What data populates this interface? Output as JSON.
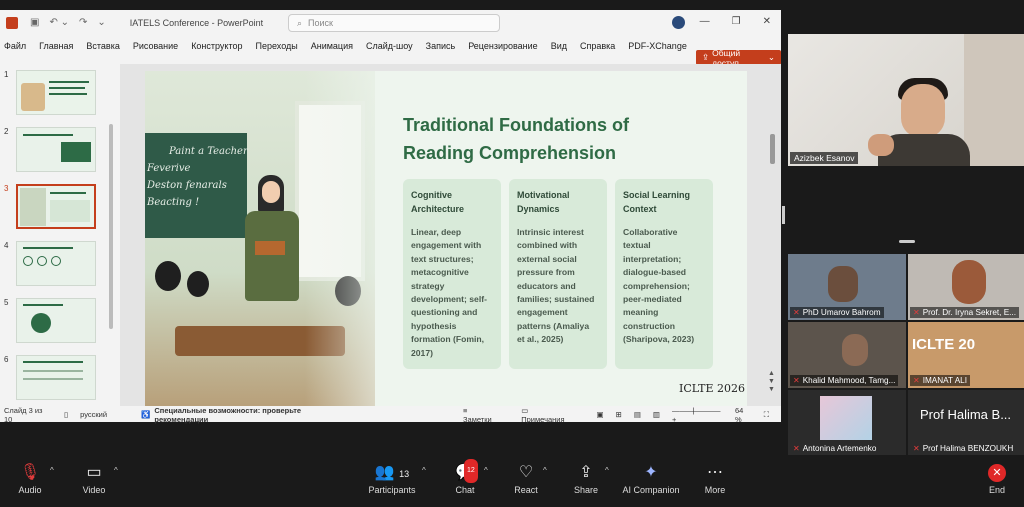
{
  "window": {
    "doc_title": "IATELS Conference  -  PowerPoint",
    "search_placeholder": "Поиск",
    "share_label": "Общий доступ"
  },
  "ribbon_tabs": [
    "Файл",
    "Главная",
    "Вставка",
    "Рисование",
    "Конструктор",
    "Переходы",
    "Анимация",
    "Слайд-шоу",
    "Запись",
    "Рецензирование",
    "Вид",
    "Справка",
    "PDF-XChange"
  ],
  "thumbnails": [
    "1",
    "2",
    "3",
    "4",
    "5",
    "6"
  ],
  "slide": {
    "title": "Traditional Foundations of Reading Comprehension",
    "board_text": [
      "Paint a Teacher",
      "Feverive",
      "Deston fenarals",
      "Beacting !"
    ],
    "cards": [
      {
        "head": "Cognitive Architecture",
        "body": "Linear, deep engagement with text structures; metacognitive strategy development; self-questioning and hypothesis formation (Fomin, 2017)"
      },
      {
        "head": "Motivational Dynamics",
        "body": "Intrinsic interest combined with external social pressure from educators and families; sustained engagement patterns (Amaliya et al., 2025)"
      },
      {
        "head": "Social Learning Context",
        "body": "Collaborative textual interpretation; dialogue-based comprehension; peer-mediated meaning construction (Sharipova, 2023)"
      }
    ],
    "footer": "ICLTE 2026"
  },
  "status": {
    "slide_info": "Слайд 3 из 10",
    "language": "русский",
    "accessibility": "Специальные возможности: проверьте рекомендации",
    "notes": "Заметки",
    "comments": "Примечания",
    "zoom": "64 %"
  },
  "participants": {
    "main_speaker": "Azizbek Esanov",
    "tiles": [
      "PhD Umarov Bahrom",
      "Prof. Dr. Iryna Sekret, E...",
      "Khalid Mahmood, Tamg...",
      "IMANAT ALI",
      "Antonina Artemenko",
      "Prof Halima BENZOUKH"
    ],
    "halima_display": "Prof Halima B...",
    "banner_text": "ICLTE 20"
  },
  "toolbar": {
    "audio": "Audio",
    "video": "Video",
    "participants_label": "Participants",
    "participants_count": "13",
    "chat": "Chat",
    "chat_badge": "12",
    "react": "React",
    "share": "Share",
    "ai": "AI Companion",
    "more": "More",
    "end": "End"
  }
}
